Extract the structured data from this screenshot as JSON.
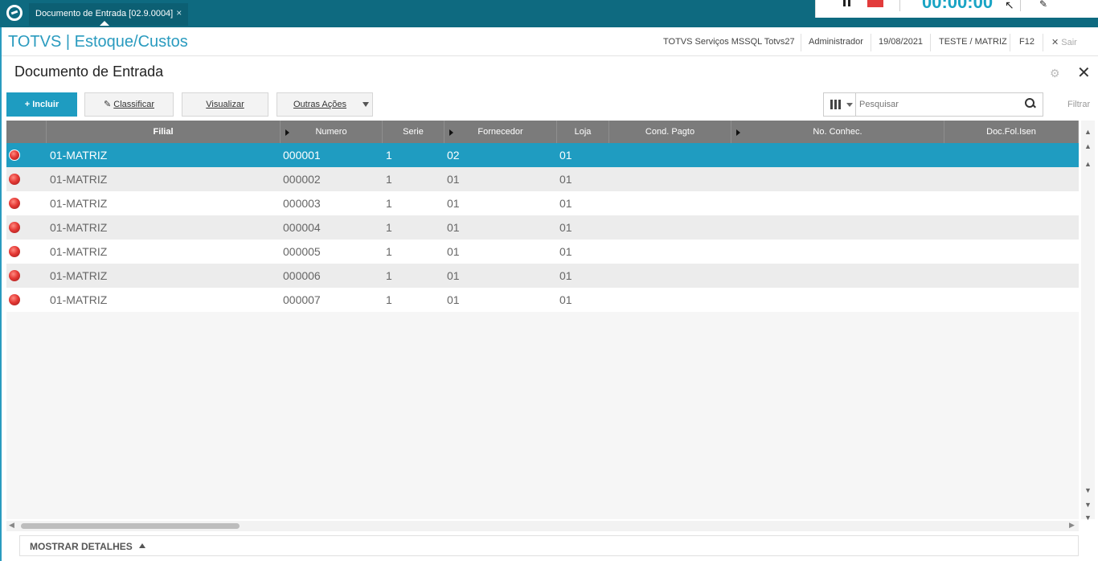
{
  "topbar": {
    "tab_title": "Documento de Entrada [02.9.0004]",
    "tab_close": "×",
    "recorder_time": "00:00:00"
  },
  "header": {
    "app_title": "TOTVS | Estoque/Custos",
    "environment": "TOTVS Serviços MSSQL Totvs27",
    "user": "Administrador",
    "date": "19/08/2021",
    "company": "TESTE / MATRIZ",
    "shortcut": "F12",
    "exit_label": "Sair"
  },
  "page": {
    "title": "Documento de Entrada"
  },
  "toolbar": {
    "include_label": "Incluir",
    "classify_label": "Classificar",
    "view_label": "Visualizar",
    "more_actions_label": "Outras Ações",
    "search_placeholder": "Pesquisar",
    "filter_label": "Filtrar"
  },
  "grid": {
    "columns": [
      "Filial",
      "Numero",
      "Serie",
      "Fornecedor",
      "Loja",
      "Cond. Pagto",
      "No. Conhec.",
      "Doc.Fol.Isen"
    ],
    "rows": [
      {
        "filial": "01-MATRIZ",
        "numero": "000001",
        "serie": "1",
        "fornecedor": "02",
        "loja": "01",
        "status": "red"
      },
      {
        "filial": "01-MATRIZ",
        "numero": "000002",
        "serie": "1",
        "fornecedor": "01",
        "loja": "01",
        "status": "red"
      },
      {
        "filial": "01-MATRIZ",
        "numero": "000003",
        "serie": "1",
        "fornecedor": "01",
        "loja": "01",
        "status": "red"
      },
      {
        "filial": "01-MATRIZ",
        "numero": "000004",
        "serie": "1",
        "fornecedor": "01",
        "loja": "01",
        "status": "red"
      },
      {
        "filial": "01-MATRIZ",
        "numero": "000005",
        "serie": "1",
        "fornecedor": "01",
        "loja": "01",
        "status": "red"
      },
      {
        "filial": "01-MATRIZ",
        "numero": "000006",
        "serie": "1",
        "fornecedor": "01",
        "loja": "01",
        "status": "red"
      },
      {
        "filial": "01-MATRIZ",
        "numero": "000007",
        "serie": "1",
        "fornecedor": "01",
        "loja": "01",
        "status": "red"
      }
    ],
    "selected_row": 0
  },
  "footer": {
    "details_label": "MOSTRAR DETALHES"
  },
  "colors": {
    "topbar": "#0e6a80",
    "accent": "#1e9cc1",
    "header_text": "#2a9bbf",
    "status_red": "#e53935"
  }
}
